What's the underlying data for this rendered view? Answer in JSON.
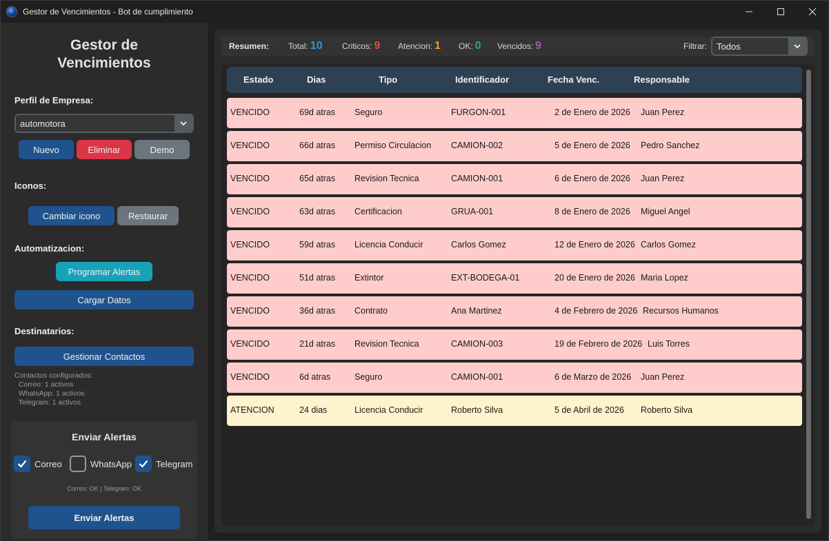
{
  "window": {
    "title": "Gestor de Vencimientos - Bot de cumplimiento"
  },
  "sidebar": {
    "app_title": "Gestor de\nVencimientos",
    "profile_label": "Perfil de Empresa:",
    "profile_value": "automotora",
    "btn_new": "Nuevo",
    "btn_delete": "Eliminar",
    "btn_demo": "Demo",
    "icons_label": "Iconos:",
    "btn_change_icon": "Cambiar icono",
    "btn_restore": "Restaurar",
    "automation_label": "Automatizacion:",
    "btn_schedule": "Programar Alertas",
    "btn_load": "Cargar Datos",
    "recipients_label": "Destinatarios:",
    "btn_manage": "Gestionar Contactos",
    "contacts_info": "Contactos configurados:\n  Correo: 1 activos\n  WhatsApp: 1 activos\n  Telegram: 1 activos",
    "send_panel": {
      "title": "Enviar Alertas",
      "channels": [
        {
          "label": "Correo",
          "checked": true
        },
        {
          "label": "WhatsApp",
          "checked": false
        },
        {
          "label": "Telegram",
          "checked": true
        }
      ],
      "status": "Correo: OK | Telegram: OK",
      "btn_send": "Enviar Alertas"
    }
  },
  "summary": {
    "title": "Resumen:",
    "total_label": "Total:",
    "total_value": "10",
    "critical_label": "Criticos:",
    "critical_value": "9",
    "attention_label": "Atencion:",
    "attention_value": "1",
    "ok_label": "OK:",
    "ok_value": "0",
    "expired_label": "Vencidos:",
    "expired_value": "9",
    "filter_label": "Filtrar:",
    "filter_value": "Todos"
  },
  "colors": {
    "total": "#3498db",
    "critical": "#e74c3c",
    "attention": "#f39c12",
    "ok": "#27ae60",
    "expired": "#9b59b6",
    "row_expired": "#ffcccc",
    "row_attention": "#fff3cd"
  },
  "table": {
    "headers": [
      "Estado",
      "Dias",
      "Tipo",
      "Identificador",
      "Fecha Venc.",
      "Responsable"
    ],
    "rows": [
      {
        "estado": "VENCIDO",
        "dias": "69d atras",
        "tipo": "Seguro",
        "id": "FURGON-001",
        "fecha": "2 de Enero de 2026",
        "resp": "Juan Perez",
        "kind": "venc"
      },
      {
        "estado": "VENCIDO",
        "dias": "66d atras",
        "tipo": "Permiso Circulacion",
        "id": "CAMION-002",
        "fecha": "5 de Enero de 2026",
        "resp": "Pedro Sanchez",
        "kind": "venc"
      },
      {
        "estado": "VENCIDO",
        "dias": "65d atras",
        "tipo": "Revision Tecnica",
        "id": "CAMION-001",
        "fecha": "6 de Enero de 2026",
        "resp": "Juan Perez",
        "kind": "venc"
      },
      {
        "estado": "VENCIDO",
        "dias": "63d atras",
        "tipo": "Certificacion",
        "id": "GRUA-001",
        "fecha": "8 de Enero de 2026",
        "resp": "Miguel Angel",
        "kind": "venc"
      },
      {
        "estado": "VENCIDO",
        "dias": "59d atras",
        "tipo": "Licencia Conducir",
        "id": "Carlos Gomez",
        "fecha": "12 de Enero de 2026",
        "resp": "Carlos Gomez",
        "kind": "venc"
      },
      {
        "estado": "VENCIDO",
        "dias": "51d atras",
        "tipo": "Extintor",
        "id": "EXT-BODEGA-01",
        "fecha": "20 de Enero de 2026",
        "resp": "Maria Lopez",
        "kind": "venc"
      },
      {
        "estado": "VENCIDO",
        "dias": "36d atras",
        "tipo": "Contrato",
        "id": "Ana Martinez",
        "fecha": "4 de Febrero de 2026",
        "resp": "Recursos Humanos",
        "kind": "venc"
      },
      {
        "estado": "VENCIDO",
        "dias": "21d atras",
        "tipo": "Revision Tecnica",
        "id": "CAMION-003",
        "fecha": "19 de Febrero de 2026",
        "resp": "Luis Torres",
        "kind": "venc"
      },
      {
        "estado": "VENCIDO",
        "dias": "6d atras",
        "tipo": "Seguro",
        "id": "CAMION-001",
        "fecha": "6 de Marzo de 2026",
        "resp": "Juan Perez",
        "kind": "venc"
      },
      {
        "estado": "ATENCION",
        "dias": "24 dias",
        "tipo": "Licencia Conducir",
        "id": "Roberto Silva",
        "fecha": "5 de Abril de 2026",
        "resp": "Roberto Silva",
        "kind": "aten"
      }
    ]
  }
}
